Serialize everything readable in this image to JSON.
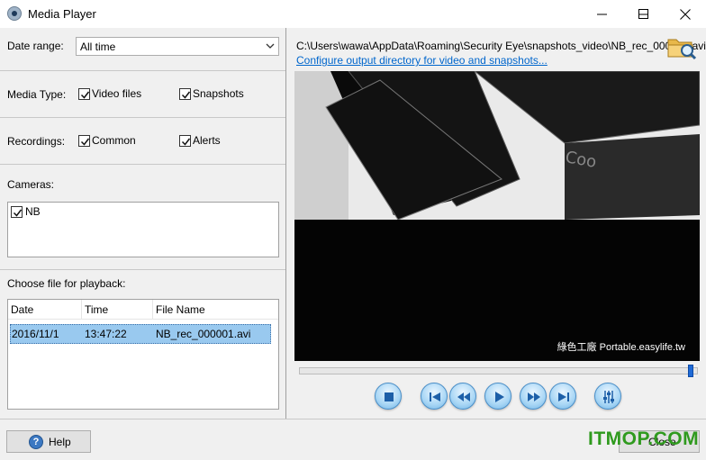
{
  "window": {
    "title": "Media Player",
    "icon": "app-icon"
  },
  "filters": {
    "date_range_label": "Date range:",
    "date_range_value": "All time",
    "media_type_label": "Media Type:",
    "video_files": {
      "label": "Video files",
      "checked": true
    },
    "snapshots": {
      "label": "Snapshots",
      "checked": true
    },
    "recordings_label": "Recordings:",
    "common": {
      "label": "Common",
      "checked": true
    },
    "alerts": {
      "label": "Alerts",
      "checked": true
    },
    "cameras_label": "Cameras:",
    "cameras": [
      {
        "label": "NB",
        "checked": true
      }
    ]
  },
  "playback": {
    "label": "Choose file for playback:",
    "columns": [
      "Date",
      "Time",
      "File Name"
    ],
    "rows": [
      {
        "date": "2016/11/1",
        "time": "13:47:22",
        "file": "NB_rec_000001.avi",
        "selected": true
      }
    ]
  },
  "player": {
    "path": "C:\\Users\\wawa\\AppData\\Roaming\\Security Eye\\snapshots_video\\NB_rec_000001.avi",
    "configure_link": "Configure output directory for video and snapshots...",
    "watermark": "綠色工廠 Portable.easylife.tw",
    "position_fraction": 0.99,
    "controls": [
      "stop-icon",
      "skip-to-start-icon",
      "rewind-icon",
      "play-icon",
      "fast-forward-icon",
      "skip-to-end-icon",
      "settings-sliders-icon"
    ]
  },
  "footer": {
    "help_label": "Help",
    "close_label": "Close",
    "brand_overlay": "ITMOP.COM"
  },
  "colors": {
    "accent": "#1f6ad6",
    "selection": "#99c9ef",
    "link": "#0066cc",
    "brand": "#2f9a1e"
  }
}
